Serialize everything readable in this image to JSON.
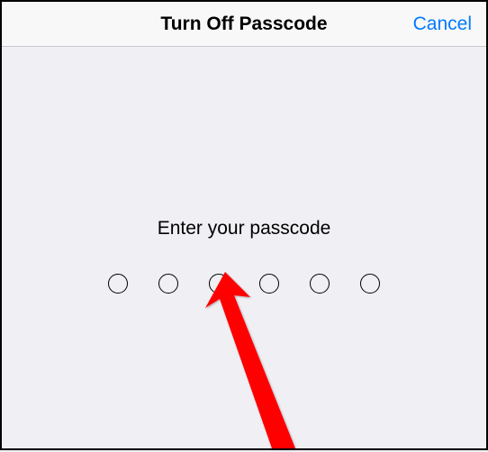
{
  "header": {
    "title": "Turn Off Passcode",
    "cancel_label": "Cancel"
  },
  "prompt": "Enter your passcode",
  "passcode": {
    "length": 6
  }
}
